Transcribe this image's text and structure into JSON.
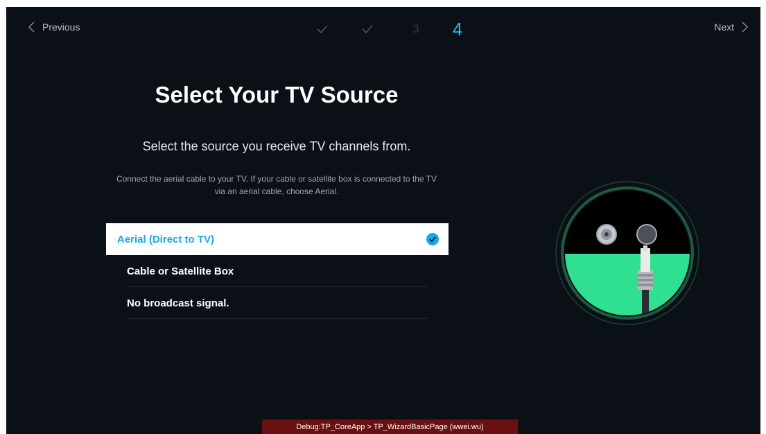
{
  "nav": {
    "previous_label": "Previous",
    "next_label": "Next"
  },
  "steps": [
    {
      "state": "done",
      "label": "✓"
    },
    {
      "state": "done",
      "label": "✓"
    },
    {
      "state": "pending",
      "label": "3"
    },
    {
      "state": "active",
      "label": "4"
    }
  ],
  "page": {
    "title": "Select Your TV Source",
    "subtitle": "Select the source you receive TV channels from.",
    "description_line1": "Connect the aerial cable to your TV. If your cable or satellite box is connected to the TV",
    "description_line2": "via an aerial cable, choose Aerial."
  },
  "options": [
    {
      "label": "Aerial (Direct to TV)",
      "selected": true
    },
    {
      "label": "Cable or Satellite Box",
      "selected": false
    },
    {
      "label": "No broadcast signal.",
      "selected": false
    }
  ],
  "debug": {
    "text": "Debug:TP_CoreApp > TP_WizardBasicPage (wwei.wu)"
  },
  "colors": {
    "background": "#0b1016",
    "accent": "#1aa7e8",
    "step_active": "#29b6f6",
    "illustration_green": "#2ee08f",
    "debug_bar": "#6b1010"
  }
}
